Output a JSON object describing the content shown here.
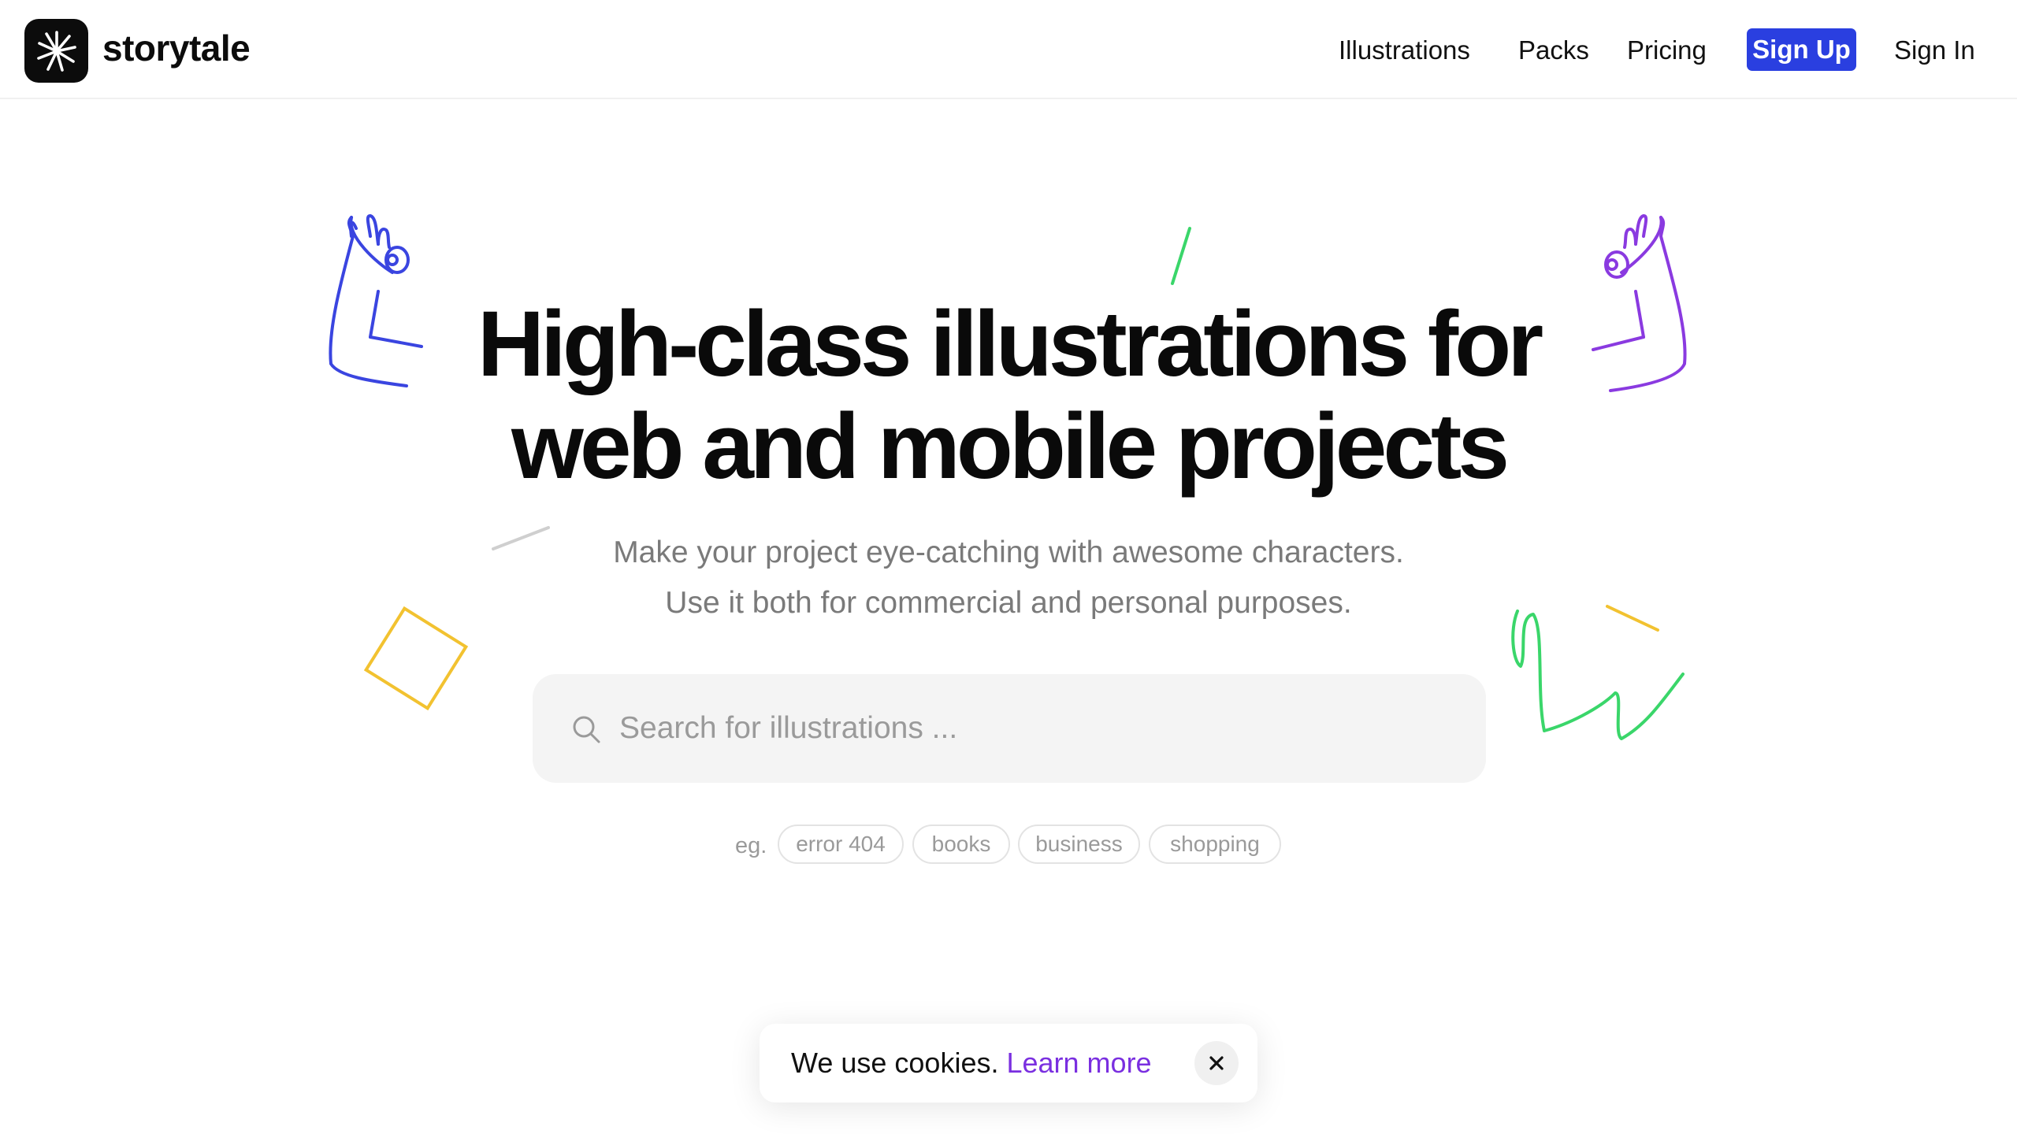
{
  "header": {
    "logo_text": "storytale",
    "nav": {
      "illustrations": "Illustrations",
      "packs": "Packs",
      "pricing": "Pricing",
      "sign_up": "Sign Up",
      "sign_in": "Sign In"
    }
  },
  "hero": {
    "title_line1": "High-class illustrations for",
    "title_line2": "web and mobile projects",
    "subtitle_line1": "Make your project eye-catching with awesome characters.",
    "subtitle_line2": "Use it both for commercial and personal purposes."
  },
  "search": {
    "placeholder": "Search for illustrations ...",
    "value": ""
  },
  "examples": {
    "prefix": "eg.",
    "tags": [
      "error 404",
      "books",
      "business",
      "shopping"
    ]
  },
  "cookie": {
    "text": "We use cookies.",
    "link": "Learn more"
  },
  "icons": {
    "logo": "starburst-logo-icon",
    "search": "search-icon",
    "close": "close-icon"
  },
  "colors": {
    "accent": "#2a3fe0",
    "link_purple": "#7a2fe0",
    "deco_blue": "#3a45e0",
    "deco_purple": "#8a3ae0",
    "deco_green": "#3ad66a",
    "deco_yellow": "#f2c230"
  }
}
